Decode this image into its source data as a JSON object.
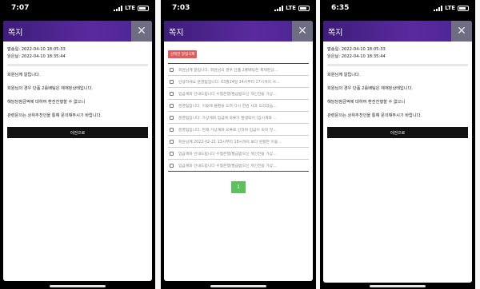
{
  "screens": [
    {
      "status": {
        "time": "7:07",
        "network": "LTE"
      },
      "modal": {
        "title": "쪽지",
        "close": "✕",
        "sent_label": "발송일: 2022-04-10 18:05:33",
        "read_label": "읽은날: 2022-04-10 18:35:44",
        "lines": [
          "회원님께 알립니다.",
          "회원님의 경우 단품 2롤배팅은 제재된상태입니다.",
          "해당당첨금액에 대하여 환전진행할 수 없으니",
          "관련문의는 상위추천인을 통해 문의해주시기 바랍니다."
        ],
        "back_button": "이전으로"
      }
    },
    {
      "status": {
        "time": "7:03",
        "network": "LTE"
      },
      "modal": {
        "title": "쪽지",
        "close": "✕",
        "delete_button": "선택한 알림삭제",
        "rows": [
          "회원님께 알립니다. 회원님의 경우 단품 2롤배팅은 제재된상…",
          "안녕하세요 운영팀입니다. 03월14일 14시부터 17시까지 서…",
          "입금계좌 안내드립니다 수협은행/발급받으신 개인전용 가상…",
          "운영팀입니다. 이용에 불편을 드려 다시 한번 사과 드리겠습…",
          "운영팀입니다. 가상계좌 입금에 오류가 발생되어 (임시계좌 …",
          "운영팀입니다. 현재 가상계좌 오류로 인하여 입금이 되지 않…",
          "회원님께 2022-02-21 13시부터 18시까지 보다 원활한 이용…",
          "입금계좌 안내드립니다 수협은행/발급받으신 개인전용 가상…",
          "입금계좌 안내드립니다 수협은행/발급받으신 개인전용 가상…"
        ],
        "page": "1"
      }
    },
    {
      "status": {
        "time": "6:35",
        "network": "LTE"
      },
      "modal": {
        "title": "쪽지",
        "close": "✕",
        "sent_label": "발송일: 2022-04-10 18:05:33",
        "read_label": "읽은날: 2022-04-10 18:35:44",
        "lines": [
          "회원님께 알립니다.",
          "회원님의 경우 단품 2롤배팅은 제재된상태입니다.",
          "해당당첨금액에 대하여 환전진행할 수 없으니",
          "관련문의는 상위추천인을 통해 문의해주시기 바랍니다."
        ],
        "back_button": "이전으로"
      }
    }
  ],
  "colors": {
    "header": "#4b2490",
    "close_bg": "#6d6d84",
    "delete_btn": "#e05b5b",
    "page_btn": "#5bc25b",
    "back_btn": "#121212"
  }
}
